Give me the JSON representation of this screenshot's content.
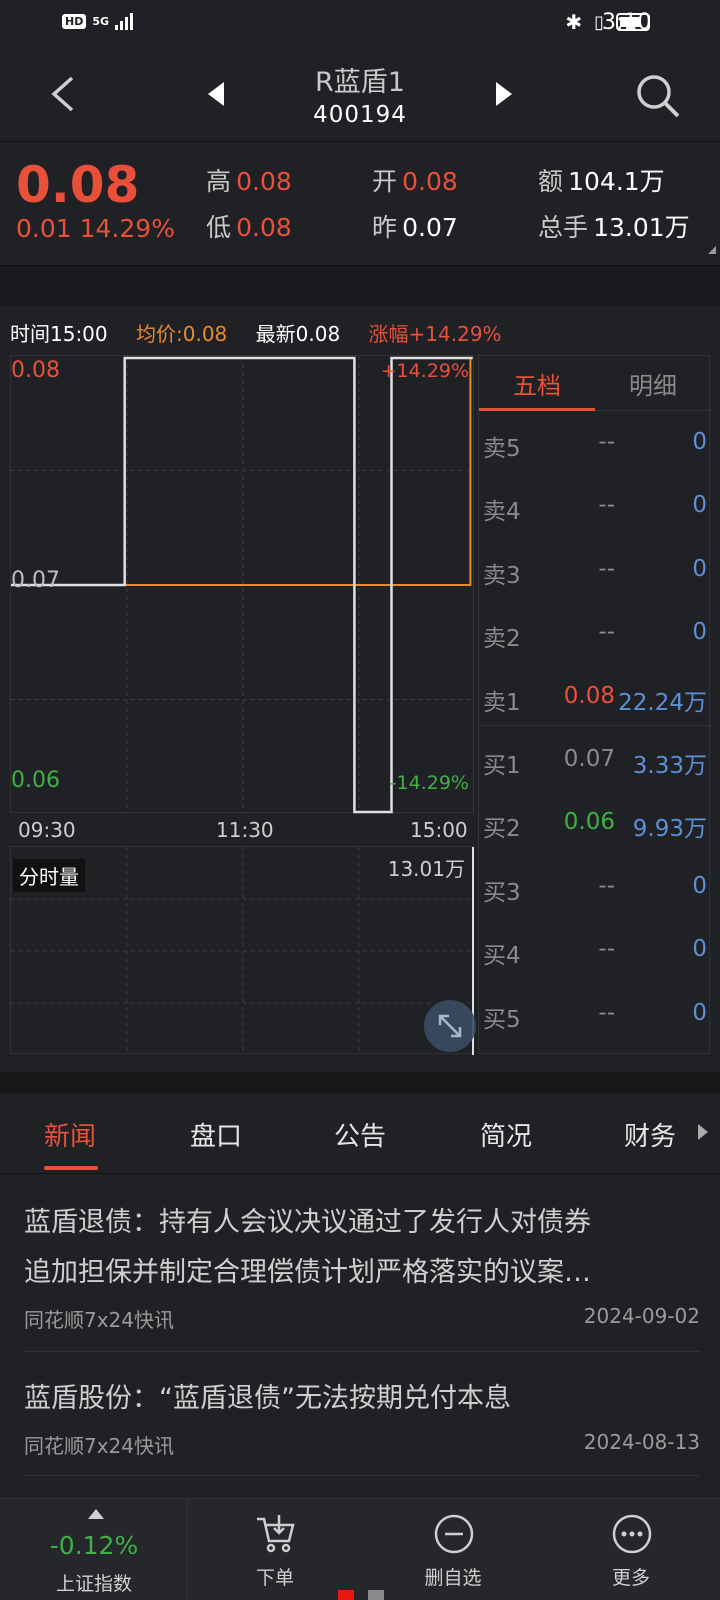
{
  "status_bar": {
    "time": "3:10",
    "network": "HD",
    "signal": "5G"
  },
  "header": {
    "title": "R蓝盾1",
    "code": "400194"
  },
  "quote": {
    "price": "0.08",
    "change": "0.01",
    "change_pct": "14.29%",
    "high_label": "高",
    "high": "0.08",
    "low_label": "低",
    "low": "0.08",
    "open_label": "开",
    "open": "0.08",
    "prev_label": "昨",
    "prev": "0.07",
    "amount_label": "额",
    "amount": "104.1万",
    "volume_label": "总手",
    "volume": "13.01万"
  },
  "chart_info": {
    "time": "时间15:00",
    "avg": "均价:0.08",
    "latest": "最新0.08",
    "change": "涨幅+14.29%"
  },
  "chart": {
    "y_top": "0.08",
    "y_mid": "0.07",
    "y_bottom": "0.06",
    "pct_top": "+14.29%",
    "pct_bottom": "-14.29%",
    "x_labels": [
      "09:30",
      "11:30",
      "15:00"
    ],
    "volume_label": "分时量",
    "volume_max": "13.01万"
  },
  "chart_data": {
    "type": "line",
    "series": [
      {
        "values": [
          0.07,
          0.07,
          0.08,
          0.08,
          0.06,
          0.06,
          0.08,
          0.08
        ]
      },
      {
        "values": [
          0.07,
          0.07,
          0.07,
          0.07,
          0.07,
          0.07,
          0.07,
          0.08
        ]
      }
    ],
    "ylim": [
      0.06,
      0.08
    ],
    "x_labels": [
      "09:30",
      "11:30",
      "15:00"
    ]
  },
  "order_book": {
    "tabs": [
      "五档",
      "明细"
    ],
    "rows": [
      {
        "label": "卖5",
        "price": "--",
        "vol": "0"
      },
      {
        "label": "卖4",
        "price": "--",
        "vol": "0"
      },
      {
        "label": "卖3",
        "price": "--",
        "vol": "0"
      },
      {
        "label": "卖2",
        "price": "--",
        "vol": "0"
      },
      {
        "label": "卖1",
        "price": "0.08",
        "vol": "22.24万"
      },
      {
        "label": "买1",
        "price": "0.07",
        "vol": "3.33万"
      },
      {
        "label": "买2",
        "price": "0.06",
        "vol": "9.93万"
      },
      {
        "label": "买3",
        "price": "--",
        "vol": "0"
      },
      {
        "label": "买4",
        "price": "--",
        "vol": "0"
      },
      {
        "label": "买5",
        "price": "--",
        "vol": "0"
      }
    ]
  },
  "info_tabs": [
    "新闻",
    "盘口",
    "公告",
    "简况",
    "财务"
  ],
  "news": [
    {
      "title_line1": "蓝盾退债：持有人会议决议通过了发行人对债券",
      "title_line2": "追加担保并制定合理偿债计划严格落实的议案…",
      "source": "同花顺7x24快讯",
      "date": "2024-09-02"
    },
    {
      "title_line1": "蓝盾股份：“蓝盾退债”无法按期兑付本息",
      "source": "同花顺7x24快讯",
      "date": "2024-08-13"
    }
  ],
  "bottom_bar": {
    "index_change": "-0.12%",
    "index_name": "上证指数",
    "order": "下单",
    "remove_watch": "删自选",
    "more": "更多"
  },
  "colors": {
    "up": "#e8503a",
    "down": "#3fb045",
    "avg_line": "#e88a2e",
    "price_line": "#e0e0e0",
    "volume_blue": "#5c8fd6"
  }
}
